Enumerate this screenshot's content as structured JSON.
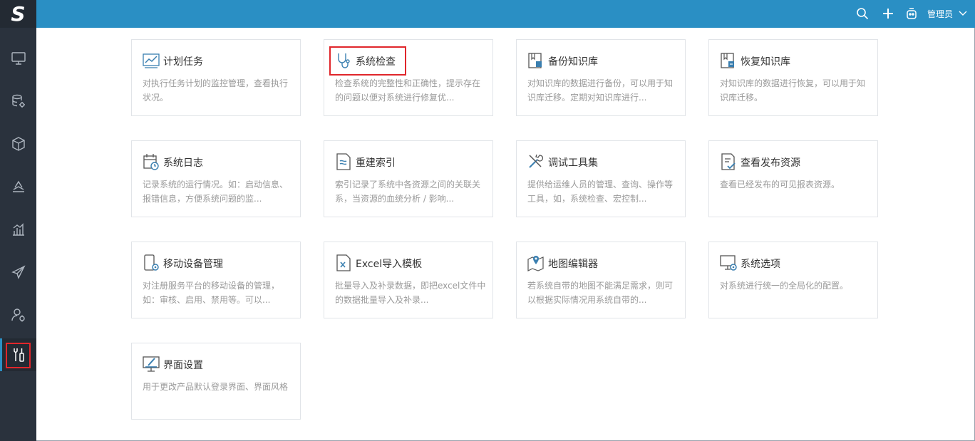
{
  "app": {
    "logo_text": "S"
  },
  "topbar": {
    "user_name": "管理员",
    "icons": [
      "search-icon",
      "plus-icon",
      "robot-icon",
      "chevron-down-icon"
    ]
  },
  "sidebar": {
    "items": [
      {
        "icon": "monitor-icon"
      },
      {
        "icon": "database-gear-icon"
      },
      {
        "icon": "cube-icon"
      },
      {
        "icon": "stack-layers-icon"
      },
      {
        "icon": "bar-chart-icon"
      },
      {
        "icon": "send-plane-icon"
      },
      {
        "icon": "user-settings-icon"
      },
      {
        "icon": "tools-icon",
        "active": true
      }
    ]
  },
  "cards": [
    {
      "title": "计划任务",
      "desc": "对执行任务计划的监控管理，查看执行状况。",
      "icon": "trend-chart-icon"
    },
    {
      "title": "系统检查",
      "desc": "检查系统的完整性和正确性，提示存在的问题以便对系统进行修复优...",
      "icon": "stethoscope-icon"
    },
    {
      "title": "备份知识库",
      "desc": "对知识库的数据进行备份，可以用于知识库迁移。定期对知识库进行...",
      "icon": "backup-book-icon"
    },
    {
      "title": "恢复知识库",
      "desc": "对知识库的数据进行恢复，可以用于知识库迁移。",
      "icon": "restore-book-icon"
    },
    {
      "title": "系统日志",
      "desc": "记录系统的运行情况。如：启动信息、报错信息，方便系统问题的监...",
      "icon": "calendar-clock-icon"
    },
    {
      "title": "重建索引",
      "desc": "索引记录了系统中各资源之间的关联关系，当资源的血统分析 / 影响...",
      "icon": "index-document-icon"
    },
    {
      "title": "调试工具集",
      "desc": "提供给运维人员的管理、查询、操作等工具，如，系统检查、宏控制...",
      "icon": "wrench-screwdriver-icon"
    },
    {
      "title": "查看发布资源",
      "desc": "查看已经发布的可见报表资源。",
      "icon": "document-check-icon"
    },
    {
      "title": "移动设备管理",
      "desc": "对注册服务平台的移动设备的管理，如：审核、启用、禁用等。可以...",
      "icon": "mobile-gear-icon"
    },
    {
      "title": "Excel导入模板",
      "desc": "批量导入及补录数据，即把excel文件中的数据批量导入及补录...",
      "icon": "excel-import-icon"
    },
    {
      "title": "地图编辑器",
      "desc": "若系统自带的地图不能满足需求，则可以根据实际情况用系统自带的...",
      "icon": "map-pin-icon"
    },
    {
      "title": "系统选项",
      "desc": "对系统进行统一的全局化的配置。",
      "icon": "monitor-gear-icon"
    },
    {
      "title": "界面设置",
      "desc": "用于更改产品默认登录界面、界面风格",
      "icon": "screen-brush-icon"
    }
  ]
}
